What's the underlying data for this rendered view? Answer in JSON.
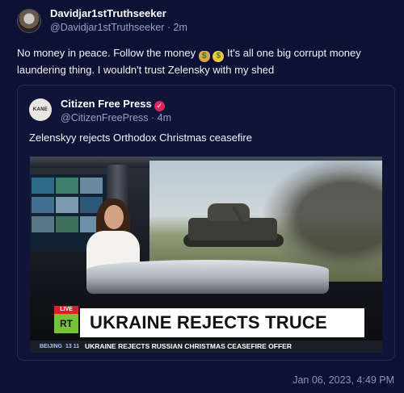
{
  "post": {
    "author_name": "Davidjar1stTruthseeker",
    "author_meta": "@Davidjar1stTruthseeker · 2m",
    "text_part1": "No money in peace. Follow the money ",
    "emoji1": "$",
    "emoji2": "$",
    "text_part2": " It's all one big corrupt money laundering thing.  I wouldn't trust Zelensky with my shed",
    "timestamp": "Jan 06, 2023, 4:49 PM"
  },
  "quote": {
    "avatar_text": "KANE",
    "author_name": "Citizen Free Press",
    "verified_glyph": "✓",
    "author_meta": "@CitizenFreePress · 4m",
    "text": "Zelenskyy rejects Orthodox Christmas ceasefire"
  },
  "media": {
    "live_label": "LIVE",
    "logo": "RT",
    "headline": "UKRAINE REJECTS TRUCE",
    "ticker_city": "BEIJING",
    "ticker_time": "13 11",
    "ticker_text": "UKRAINE REJECTS RUSSIAN CHRISTMAS CEASEFIRE OFFER"
  },
  "colors": {
    "background": "#0d1235",
    "verified": "#e0245e",
    "live": "#d9212b",
    "rt_green": "#78c23a"
  }
}
